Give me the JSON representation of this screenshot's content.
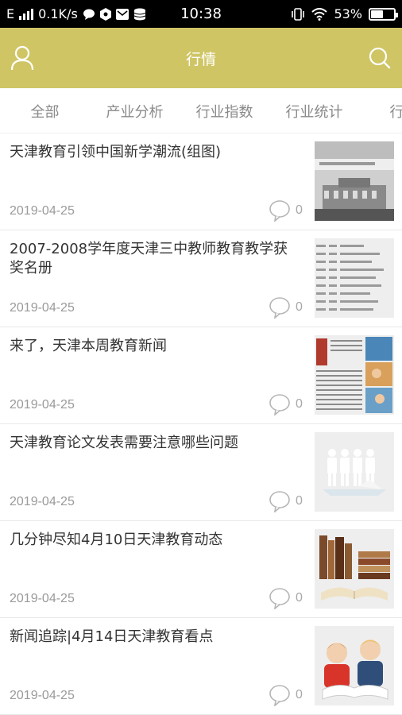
{
  "status_bar": {
    "network_type": "E",
    "speed": "0.1K/s",
    "time": "10:38",
    "battery_percent": "53%",
    "battery_level": 0.53
  },
  "header": {
    "title": "行情",
    "icons": [
      "user-icon",
      "search-icon"
    ],
    "color": "#cfc565"
  },
  "tabs": [
    "全部",
    "产业分析",
    "行业指数",
    "行业统计",
    "行业"
  ],
  "news": [
    {
      "title": "天津教育引领中国新学潮流(组图)",
      "date": "2019-04-25",
      "comments": "0"
    },
    {
      "title": "2007-2008学年度天津三中教师教育教学获奖名册",
      "date": "2019-04-25",
      "comments": "0"
    },
    {
      "title": "来了，天津本周教育新闻",
      "date": "2019-04-25",
      "comments": "0"
    },
    {
      "title": "天津教育论文发表需要注意哪些问题",
      "date": "2019-04-25",
      "comments": "0"
    },
    {
      "title": "几分钟尽知4月10日天津教育动态",
      "date": "2019-04-25",
      "comments": "0"
    },
    {
      "title": "新闻追踪|4月14日天津教育看点",
      "date": "2019-04-25",
      "comments": "0"
    }
  ]
}
